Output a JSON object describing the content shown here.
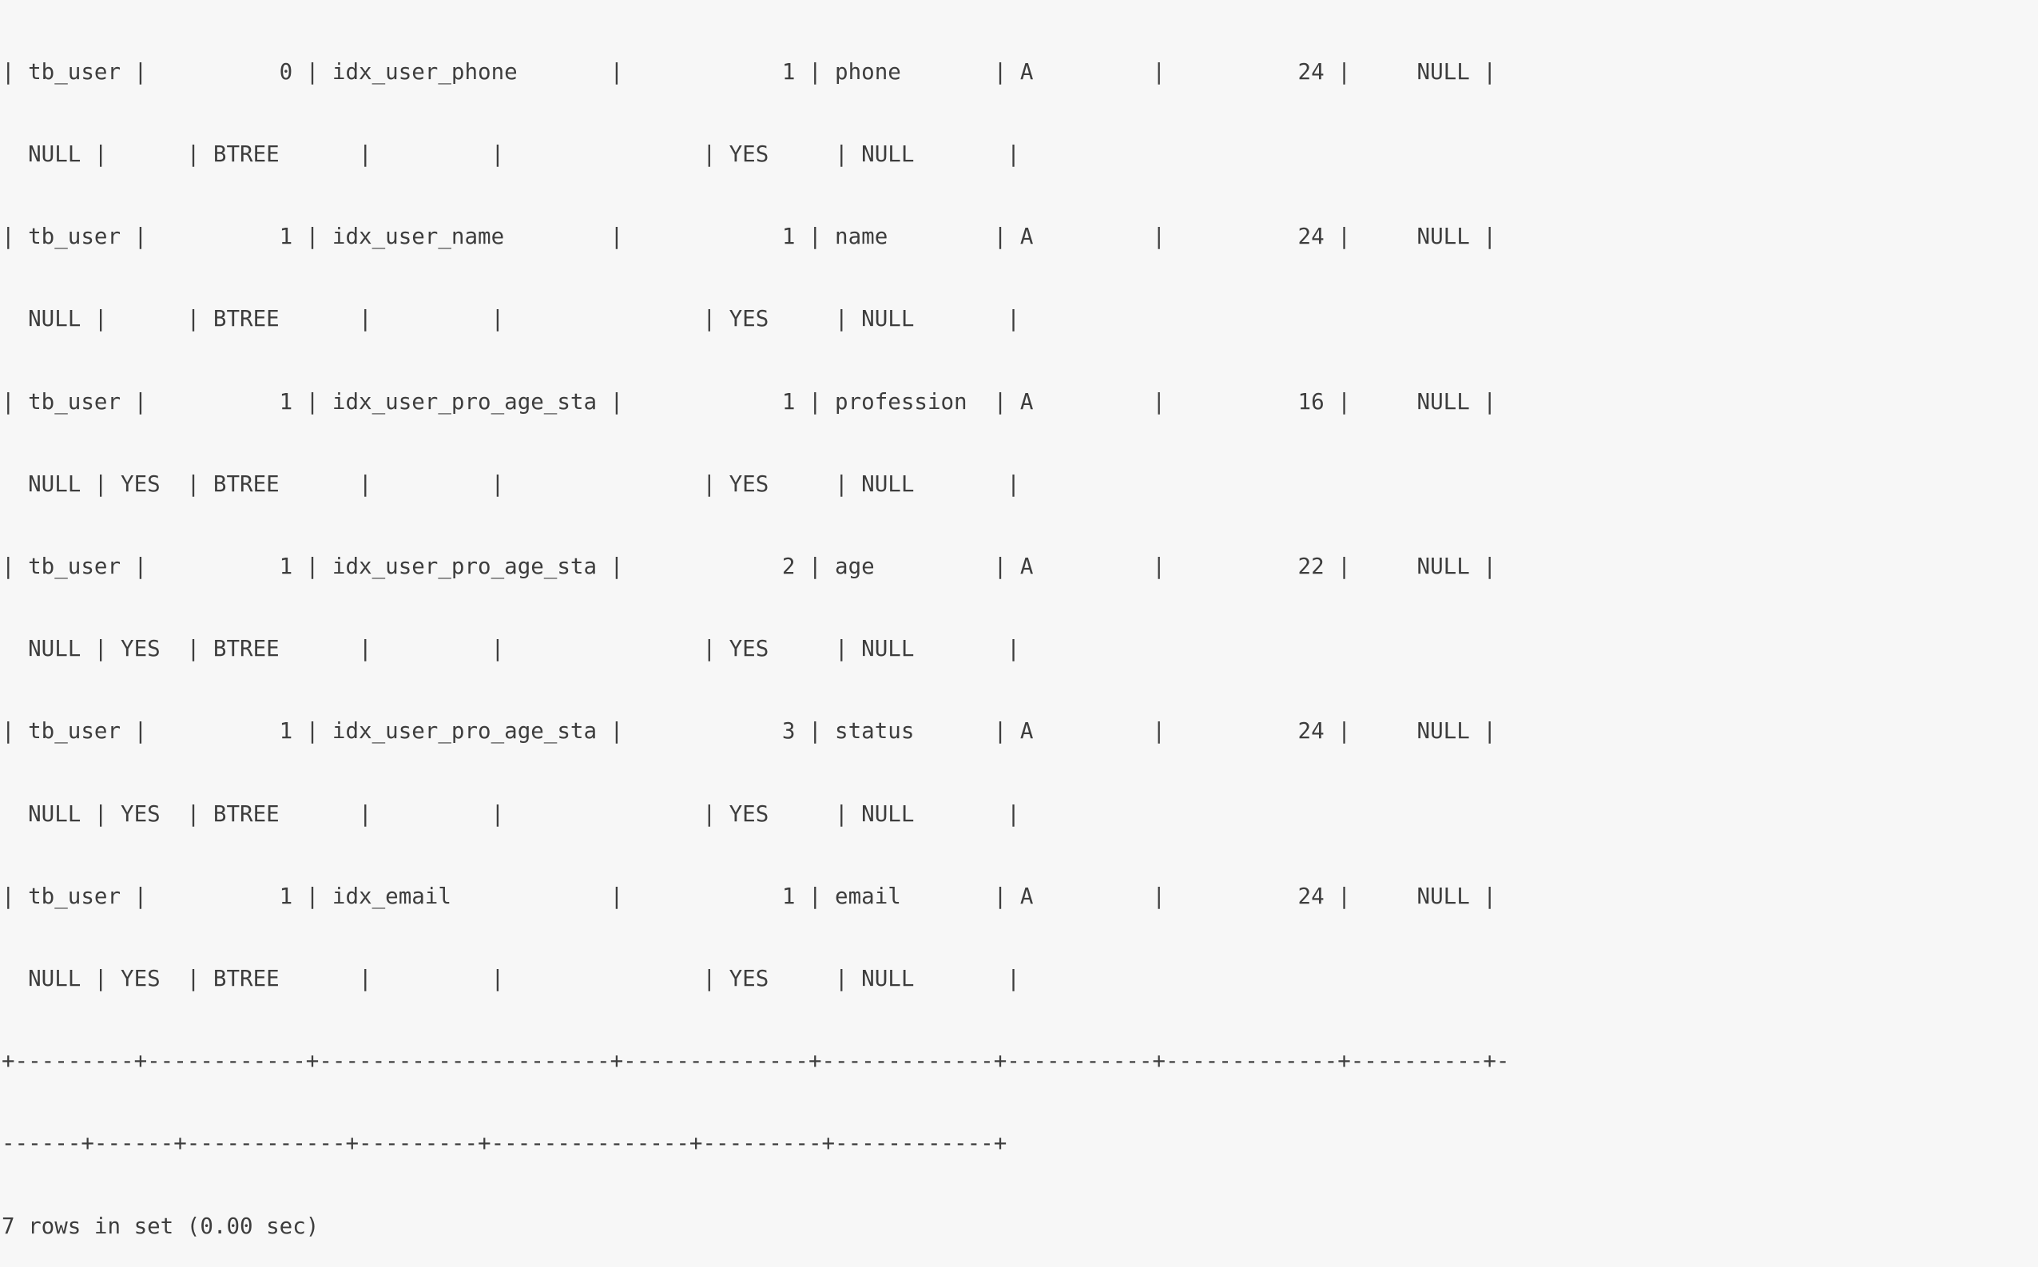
{
  "terminal": {
    "background_color": "#f7f7f7",
    "foreground_color": "#3d3d3d",
    "query_result_footer": "7 rows in set (0.00 sec)",
    "lines": [
      "| tb_user |          0 | idx_user_phone       |            1 | phone       | A         |          24 |     NULL |",
      "  NULL |      | BTREE      |         |               | YES     | NULL       |",
      "| tb_user |          1 | idx_user_name        |            1 | name        | A         |          24 |     NULL |",
      "  NULL |      | BTREE      |         |               | YES     | NULL       |",
      "| tb_user |          1 | idx_user_pro_age_sta |            1 | profession  | A         |          16 |     NULL |",
      "  NULL | YES  | BTREE      |         |               | YES     | NULL       |",
      "| tb_user |          1 | idx_user_pro_age_sta |            2 | age         | A         |          22 |     NULL |",
      "  NULL | YES  | BTREE      |         |               | YES     | NULL       |",
      "| tb_user |          1 | idx_user_pro_age_sta |            3 | status      | A         |          24 |     NULL |",
      "  NULL | YES  | BTREE      |         |               | YES     | NULL       |",
      "| tb_user |          1 | idx_email            |            1 | email       | A         |          24 |     NULL |",
      "  NULL | YES  | BTREE      |         |               | YES     | NULL       |",
      "+---------+------------+----------------------+--------------+-------------+-----------+-------------+----------+-",
      "------+------+------------+---------+---------------+---------+------------+",
      "7 rows in set (0.00 sec)"
    ],
    "rows": [
      {
        "table": "tb_user",
        "non_unique": "0",
        "key_name": "idx_user_phone",
        "seq_in_index": "1",
        "column_name": "phone",
        "collation": "A",
        "cardinality": "24",
        "sub_part": "NULL",
        "packed": "NULL",
        "null": "",
        "index_type": "BTREE",
        "comment": "",
        "index_comment": "",
        "visible": "YES",
        "expression": "NULL"
      },
      {
        "table": "tb_user",
        "non_unique": "1",
        "key_name": "idx_user_name",
        "seq_in_index": "1",
        "column_name": "name",
        "collation": "A",
        "cardinality": "24",
        "sub_part": "NULL",
        "packed": "NULL",
        "null": "",
        "index_type": "BTREE",
        "comment": "",
        "index_comment": "",
        "visible": "YES",
        "expression": "NULL"
      },
      {
        "table": "tb_user",
        "non_unique": "1",
        "key_name": "idx_user_pro_age_sta",
        "seq_in_index": "1",
        "column_name": "profession",
        "collation": "A",
        "cardinality": "16",
        "sub_part": "NULL",
        "packed": "NULL",
        "null": "YES",
        "index_type": "BTREE",
        "comment": "",
        "index_comment": "",
        "visible": "YES",
        "expression": "NULL"
      },
      {
        "table": "tb_user",
        "non_unique": "1",
        "key_name": "idx_user_pro_age_sta",
        "seq_in_index": "2",
        "column_name": "age",
        "collation": "A",
        "cardinality": "22",
        "sub_part": "NULL",
        "packed": "NULL",
        "null": "YES",
        "index_type": "BTREE",
        "comment": "",
        "index_comment": "",
        "visible": "YES",
        "expression": "NULL"
      },
      {
        "table": "tb_user",
        "non_unique": "1",
        "key_name": "idx_user_pro_age_sta",
        "seq_in_index": "3",
        "column_name": "status",
        "collation": "A",
        "cardinality": "24",
        "sub_part": "NULL",
        "packed": "NULL",
        "null": "YES",
        "index_type": "BTREE",
        "comment": "",
        "index_comment": "",
        "visible": "YES",
        "expression": "NULL"
      },
      {
        "table": "tb_user",
        "non_unique": "1",
        "key_name": "idx_email",
        "seq_in_index": "1",
        "column_name": "email",
        "collation": "A",
        "cardinality": "24",
        "sub_part": "NULL",
        "packed": "NULL",
        "null": "YES",
        "index_type": "BTREE",
        "comment": "",
        "index_comment": "",
        "visible": "YES",
        "expression": "NULL"
      }
    ]
  }
}
